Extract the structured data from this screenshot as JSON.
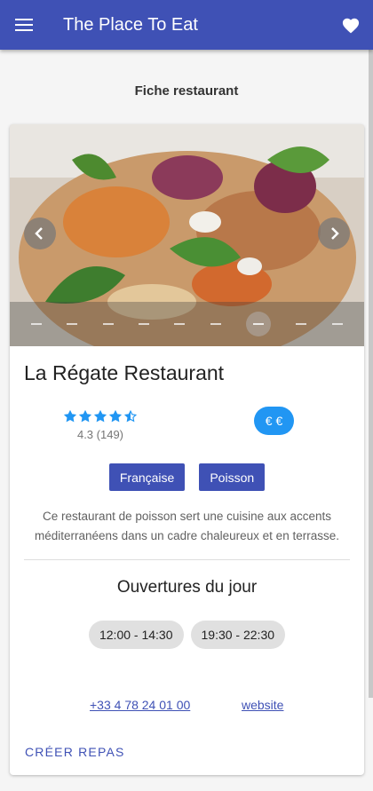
{
  "appbar": {
    "title": "The Place To Eat",
    "menu_icon": "menu-icon",
    "favorite_icon": "heart-icon"
  },
  "page_title": "Fiche restaurant",
  "restaurant": {
    "name": "La Régate Restaurant",
    "stars": 4.5,
    "rating_text": "4.3 (149)",
    "price": "€ €",
    "tags": [
      "Française",
      "Poisson"
    ],
    "description": "Ce restaurant de poisson sert une cuisine aux accents méditerranéens dans un cadre chaleureux et en terrasse.",
    "hours_title": "Ouvertures du jour",
    "hours": [
      "12:00 - 14:30",
      "19:30 - 22:30"
    ],
    "phone": "+33 4 78 24 01 00",
    "website": "website",
    "action": "CRÉER REPAS"
  },
  "carousel": {
    "indicator_count": 9,
    "active_index": 6
  },
  "colors": {
    "primary": "#3f51b5",
    "accent": "#2196f3",
    "star": "#2196f3"
  }
}
